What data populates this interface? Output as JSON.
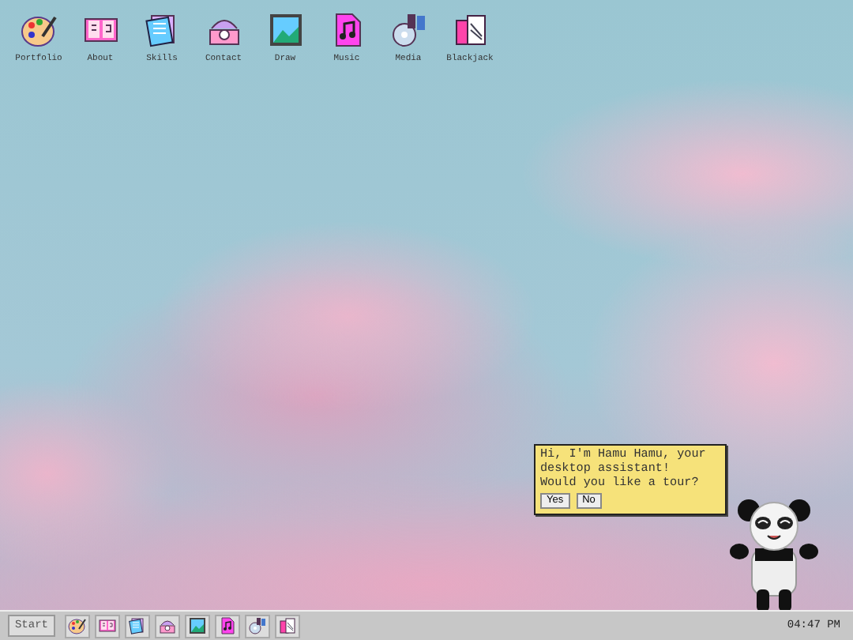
{
  "desktop_icons": [
    {
      "label": "Portfolio",
      "kind": "palette"
    },
    {
      "label": "About",
      "kind": "book"
    },
    {
      "label": "Skills",
      "kind": "notepad"
    },
    {
      "label": "Contact",
      "kind": "phone"
    },
    {
      "label": "Draw",
      "kind": "picture"
    },
    {
      "label": "Music",
      "kind": "music"
    },
    {
      "label": "Media",
      "kind": "disc"
    },
    {
      "label": "Blackjack",
      "kind": "cards"
    }
  ],
  "assistant": {
    "message": [
      "Hi, I'm Hamu Hamu, your desktop assistant!",
      "Would you like a tour?"
    ],
    "buttons": [
      "Yes",
      "No"
    ]
  },
  "taskbar": {
    "start": "Start",
    "apps": [
      {
        "kind": "palette"
      },
      {
        "kind": "book"
      },
      {
        "kind": "notepad"
      },
      {
        "kind": "phone"
      },
      {
        "kind": "picture"
      },
      {
        "kind": "music"
      },
      {
        "kind": "disc"
      },
      {
        "kind": "cards"
      }
    ],
    "clock": "04:47 PM"
  }
}
